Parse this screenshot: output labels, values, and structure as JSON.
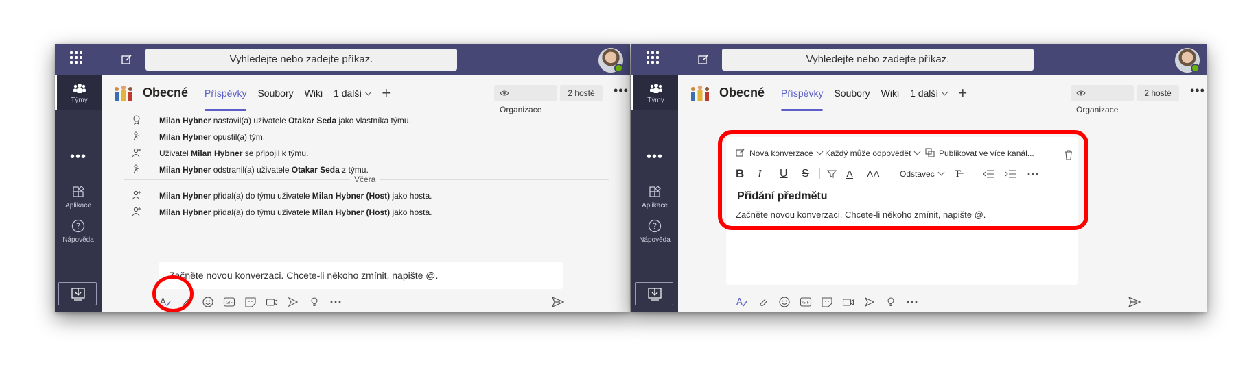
{
  "search": {
    "placeholder": "Vyhledejte nebo zadejte příkaz."
  },
  "rail": {
    "teams": "Týmy",
    "apps": "Aplikace",
    "help": "Nápověda"
  },
  "header": {
    "channel": "Obecné",
    "tabs": [
      "Příspěvky",
      "Soubory",
      "Wiki",
      "1 další"
    ],
    "org_button": "Organizace",
    "guests_button": "2 hosté"
  },
  "activity": [
    {
      "actor": "Milan Hybner",
      "action": " nastavil(a) uživatele ",
      "target": "Otakar Seda",
      "tail": " jako vlastníka týmu."
    },
    {
      "actor": "Milan Hybner",
      "action": " opustil(a) tým.",
      "target": "",
      "tail": ""
    },
    {
      "pre": "Uživatel ",
      "actor": "Milan Hybner",
      "action": " se připojil k týmu.",
      "target": "",
      "tail": ""
    },
    {
      "actor": "Milan Hybner",
      "action": " odstranil(a) uživatele ",
      "target": "Otakar Seda",
      "tail": " z týmu."
    },
    {
      "actor": "Milan Hybner",
      "action": " přidal(a) do týmu uživatele ",
      "target": "Milan Hybner (Host)",
      "tail": " jako hosta."
    },
    {
      "actor": "Milan Hybner",
      "action": " přidal(a) do týmu uživatele ",
      "target": "Milan Hybner (Host)",
      "tail": " jako hosta."
    }
  ],
  "divider": "Včera",
  "compose": {
    "placeholder": "Začněte novou konverzaci. Chcete-li někoho zmínit, napište @."
  },
  "rich": {
    "new_conv": "Nová konverzace",
    "reply": "Každý může odpovědět",
    "publish": "Publikovat ve více kanál...",
    "paragraph": "Odstavec",
    "subject": "Přidání předmětu",
    "body": "Začněte novou konverzaci. Chcete-li někoho zmínit, napište @."
  },
  "colors": {
    "topbar": "#464775",
    "rail": "#33344a",
    "accent": "#5b5fc7",
    "highlight": "#ff0000"
  }
}
